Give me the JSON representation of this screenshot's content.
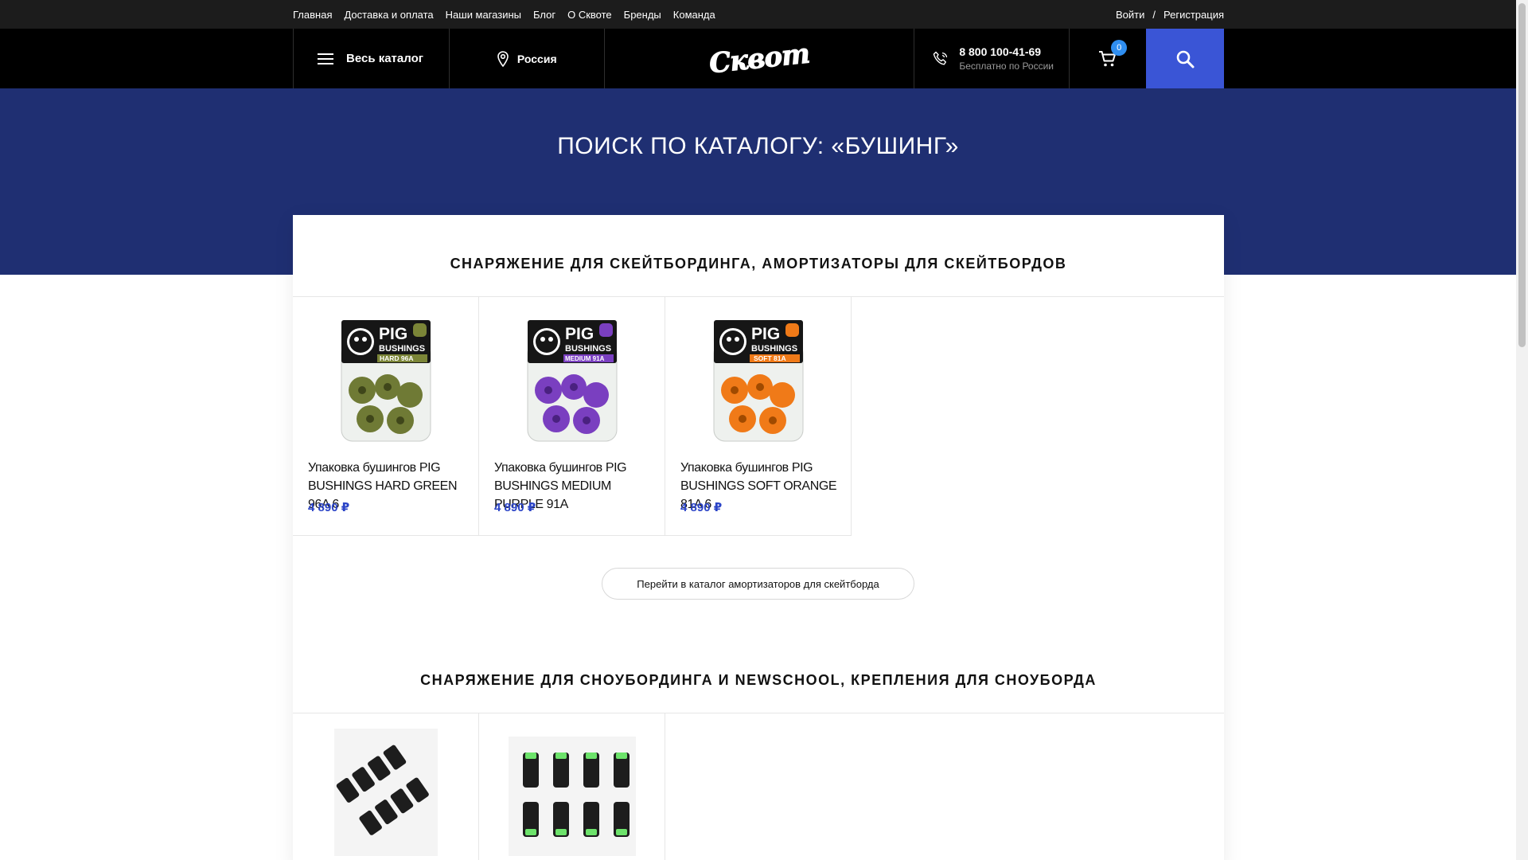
{
  "topbar": {
    "nav": [
      "Главная",
      "Доставка и оплата",
      "Наши магазины",
      "Блог",
      "О Сквоте",
      "Бренды",
      "Команда"
    ],
    "login": "Войти",
    "sep": "/",
    "register": "Регистрация"
  },
  "header": {
    "catalog_label": "Весь каталог",
    "region": "Россия",
    "logo_text": "Сквот",
    "phone": "8 800 100-41-69",
    "phone_note": "Бесплатно по России",
    "cart_count": "0"
  },
  "hero": {
    "title": "ПОИСК ПО КАТАЛОГУ: «БУШИНГ»"
  },
  "sections": [
    {
      "title": "СНАРЯЖЕНИЕ ДЛЯ СКЕЙТБОРДИНГА, АМОРТИЗАТОРЫ ДЛЯ СКЕЙТБОРДОВ",
      "products": [
        {
          "name": "Упаковка бушингов PIG BUSHINGS HARD GREEN 96A 6",
          "price": "4 890 ₽",
          "pack_brand": "PIG",
          "pack_line": "BUSHINGS",
          "pack_grade": "HARD 96A",
          "color": "#6f7a35"
        },
        {
          "name": "Упаковка бушингов PIG BUSHINGS MEDIUM PURPLE 91A",
          "price": "4 890 ₽",
          "pack_brand": "PIG",
          "pack_line": "BUSHINGS",
          "pack_grade": "MEDIUM 91A",
          "color": "#7a3fc0"
        },
        {
          "name": "Упаковка бушингов PIG BUSHINGS SOFT ORANGE 81A 6",
          "price": "4 890 ₽",
          "pack_brand": "PIG",
          "pack_line": "BUSHINGS",
          "pack_grade": "SOFT 81A",
          "color": "#f07a18"
        }
      ],
      "cta": "Перейти в каталог амортизаторов для скейтборда"
    },
    {
      "title": "СНАРЯЖЕНИЕ ДЛЯ СНОУБОРДИНГА И NEWSCHOOL, КРЕПЛЕНИЯ ДЛЯ СНОУБОРДА"
    }
  ],
  "colors": {
    "accent": "#3a55d6",
    "hero_bg": "#1f2f72",
    "price": "#2b44c7"
  }
}
